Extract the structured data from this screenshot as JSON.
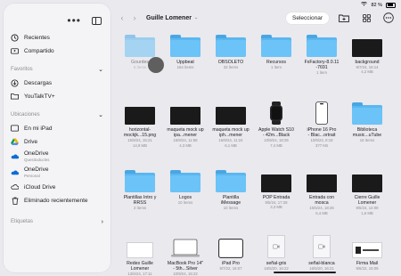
{
  "status": {
    "wifi_icon": "wifi-icon",
    "battery": "82 %"
  },
  "sidebar": {
    "items_top": [
      {
        "label": "Recientes",
        "icon": "clock-icon"
      },
      {
        "label": "Compartido",
        "icon": "shared-folder-icon"
      }
    ],
    "favoritos_header": "Favoritos",
    "favoritos": [
      {
        "label": "Descargas",
        "icon": "download-icon"
      },
      {
        "label": "YouTalkTV+",
        "icon": "folder-icon"
      }
    ],
    "ubicaciones_header": "Ubicaciones",
    "ubicaciones": [
      {
        "label": "En mi iPad",
        "sub": "",
        "icon": "ipad-icon"
      },
      {
        "label": "Drive",
        "sub": "",
        "icon": "drive-icon"
      },
      {
        "label": "OneDrive",
        "sub": "Quesitoducles",
        "icon": "onedrive-icon"
      },
      {
        "label": "OneDrive",
        "sub": "Personal",
        "icon": "onedrive-icon"
      },
      {
        "label": "iCloud Drive",
        "sub": "",
        "icon": "cloud-icon"
      },
      {
        "label": "Eliminado recientemente",
        "sub": "",
        "icon": "trash-icon"
      }
    ],
    "etiquetas_header": "Etiquetas"
  },
  "toolbar": {
    "title": "Guille Lomener",
    "select_label": "Seleccionar"
  },
  "files": [
    {
      "name": "Gourdes",
      "meta1": "5 ítems",
      "meta2": "",
      "thumb": "folder",
      "dragging": true
    },
    {
      "name": "Uppbeat",
      "meta1": "164 ítems",
      "meta2": "",
      "thumb": "folder"
    },
    {
      "name": "OBSOLETO",
      "meta1": "33 ítems",
      "meta2": "",
      "thumb": "folder"
    },
    {
      "name": "Recursos",
      "meta1": "1 ítem",
      "meta2": "",
      "thumb": "folder"
    },
    {
      "name": "FxFactory-8.0.11",
      "name2": "-7691",
      "meta1": "1 ítem",
      "meta2": "",
      "thumb": "folder"
    },
    {
      "name": "background",
      "meta1": "9/7/24, 15:14",
      "meta2": "4,2 MB",
      "thumb": "black"
    },
    {
      "name": "horizontal-",
      "name2": "mockjk...15.png",
      "meta1": "15/8/24, 15:21",
      "meta2": "14,9 MB",
      "thumb": "black"
    },
    {
      "name": "maqueta mock up",
      "name2": "ipa...mener",
      "meta1": "16/8/24, 11:58",
      "meta2": "4,3 MB",
      "thumb": "black"
    },
    {
      "name": "maqueta mock up",
      "name2": "iph...mener",
      "meta1": "16/8/24, 11:24",
      "meta2": "6,1 MB",
      "thumb": "black"
    },
    {
      "name": "Apple Watch S10",
      "name2": "- 42m...Black",
      "meta1": "10/9/24, 18:25",
      "meta2": "7,4 MB",
      "thumb": "watch"
    },
    {
      "name": "iPhone 16 Pro",
      "name2": "- Blac...ortrait",
      "meta1": "10/9/24, 8:18",
      "meta2": "377 KB",
      "thumb": "phone"
    },
    {
      "name": "Biblioteca",
      "name2": "music...uTube",
      "meta1": "16 ítems",
      "meta2": "",
      "thumb": "folder"
    },
    {
      "name": "Plantillas Intro y",
      "name2": "RRSS",
      "meta1": "2 ítems",
      "meta2": "",
      "thumb": "folder"
    },
    {
      "name": "Logos",
      "meta1": "10 ítems",
      "meta2": "",
      "thumb": "folder"
    },
    {
      "name": "Plantilla",
      "name2": "iMessage",
      "meta1": "10 ítems",
      "meta2": "",
      "thumb": "folder"
    },
    {
      "name": "POP Entrada",
      "meta1": "9/5/24, 17:28",
      "meta2": "3,3 MB",
      "thumb": "black"
    },
    {
      "name": "Entrada con",
      "name2": "mosca",
      "meta1": "15/5/24, 18:26",
      "meta2": "6,4 MB",
      "thumb": "black"
    },
    {
      "name": "Cierre Guille",
      "name2": "Lomener",
      "meta1": "9/5/24, 14:08",
      "meta2": "1,6 MB",
      "thumb": "black"
    },
    {
      "name": "Redes Guille",
      "name2": "Lomener",
      "meta1": "13/6/24, 17:11",
      "meta2": "",
      "thumb": "white"
    },
    {
      "name": "MacBook Pro 14\"",
      "name2": "- 5th...Silver",
      "meta1": "10/9/24, 15:22",
      "meta2": "",
      "thumb": "laptop"
    },
    {
      "name": "iPad Pro",
      "meta1": "9/7/22, 16:07",
      "meta2": "",
      "thumb": "ipad"
    },
    {
      "name": "señal-gris",
      "meta1": "16/5/20, 16:22",
      "meta2": "",
      "thumb": "doc"
    },
    {
      "name": "señal-blanca",
      "meta1": "16/5/20, 16:21",
      "meta2": "",
      "thumb": "doc"
    },
    {
      "name": "Firma Mail",
      "meta1": "9/6/22, 15:09",
      "meta2": "",
      "thumb": "firma"
    }
  ]
}
